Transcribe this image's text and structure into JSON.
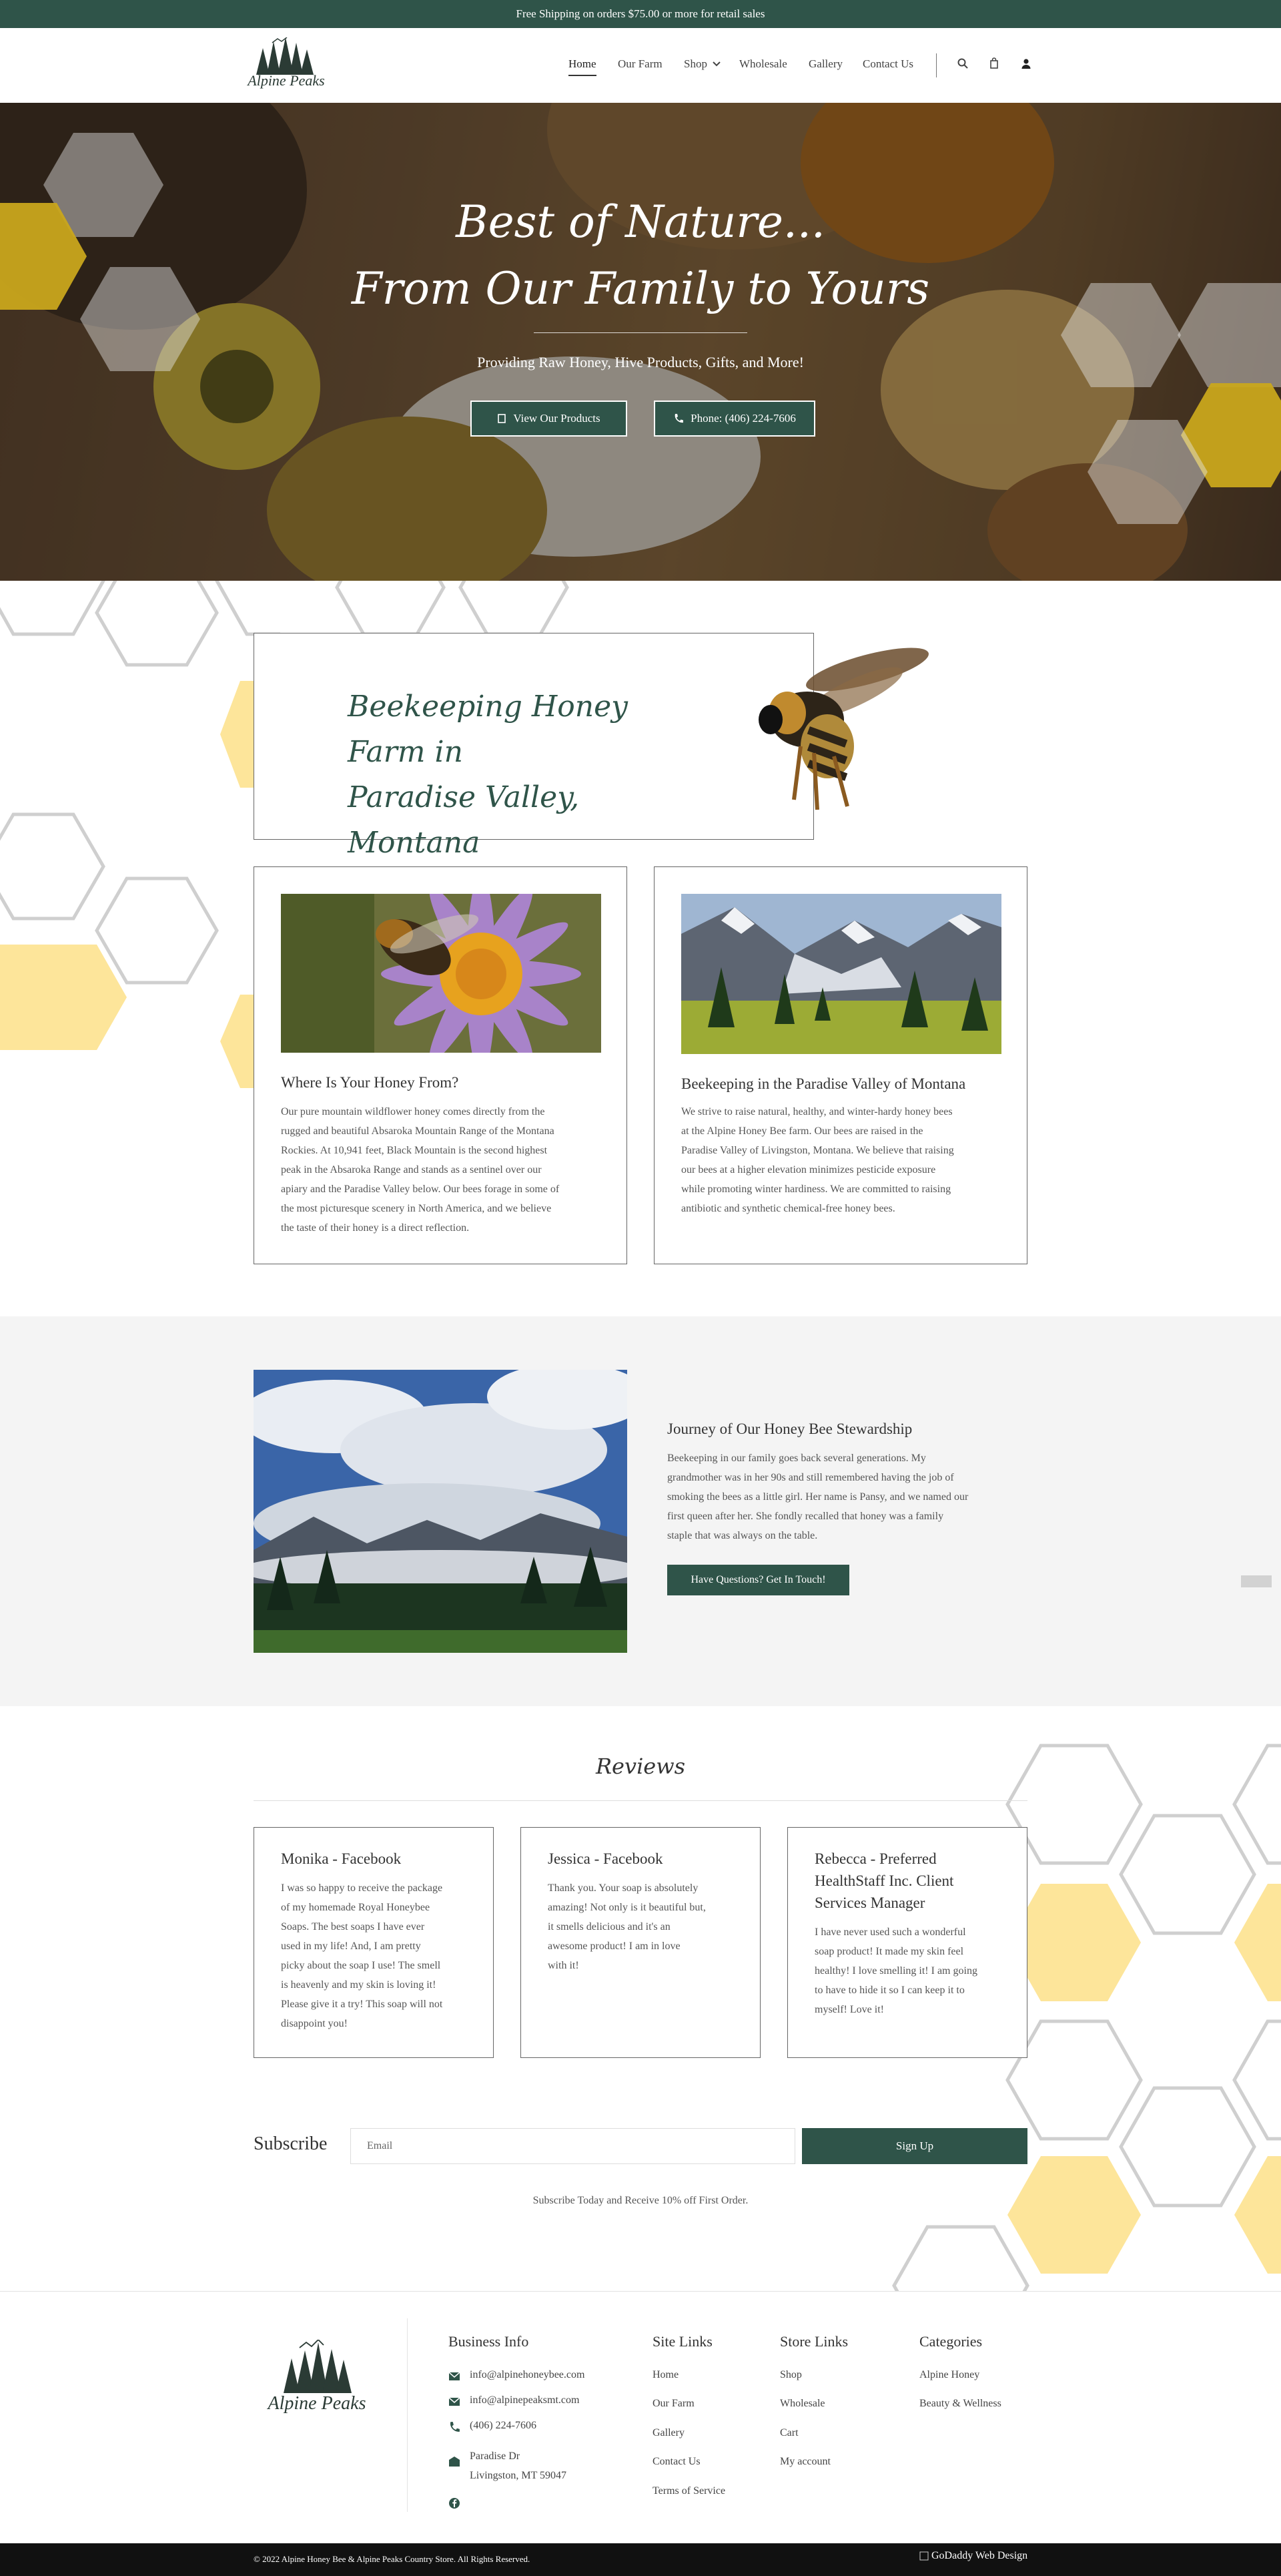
{
  "announcement": "Free Shipping on orders $75.00 or more for retail sales",
  "brand": {
    "name": "Alpine Peaks"
  },
  "nav": {
    "home": "Home",
    "farm": "Our Farm",
    "shop": "Shop",
    "wholesale": "Wholesale",
    "gallery": "Gallery",
    "contact": "Contact Us"
  },
  "hero": {
    "title_line1": "Best of Nature...",
    "title_line2": "From Our Family to Yours",
    "subtitle": "Providing Raw Honey, Hive Products, Gifts, and More!",
    "btn_products": "View Our Products",
    "btn_phone": "Phone: (406) 224-7606"
  },
  "intro": {
    "title_line1": "Beekeeping Honey Farm in",
    "title_line2": "Paradise Valley, Montana"
  },
  "cards": [
    {
      "title": "Where Is Your Honey From?",
      "lines": [
        "Our pure mountain wildflower honey comes directly from the",
        "rugged and beautiful Absaroka Mountain Range of the Montana",
        "Rockies. At 10,941 feet, Black Mountain is the second highest",
        "peak in the Absaroka Range and stands as a sentinel over our",
        "apiary and the Paradise Valley below. Our bees forage in some of",
        "the most picturesque scenery in North America, and we believe",
        "the taste of their honey is a direct reflection."
      ]
    },
    {
      "title": "Beekeeping in the Paradise Valley of Montana",
      "lines": [
        "We strive to raise natural, healthy, and winter-hardy honey bees",
        "at the Alpine Honey Bee farm. Our bees are raised in the",
        "Paradise Valley of Livingston, Montana. We believe that raising",
        "our bees at a higher elevation minimizes pesticide exposure",
        "while promoting winter hardiness. We are committed to raising",
        "antibiotic and synthetic chemical-free honey bees."
      ]
    }
  ],
  "journey": {
    "title": "Journey of Our Honey Bee Stewardship",
    "lines": [
      "Beekeeping in our family goes back several generations. My",
      "grandmother was in her 90s and still remembered having the job of",
      "smoking the bees as a little girl. Her name is Pansy, and we named our",
      "first queen after her. She fondly recalled that honey was a family",
      "staple that was always on the table."
    ],
    "button": "Have Questions? Get In Touch!"
  },
  "reviews": {
    "heading": "Reviews",
    "items": [
      {
        "name_lines": [
          "Monika - Facebook"
        ],
        "lines": [
          "I was so happy to receive the package",
          "of my homemade Royal Honeybee",
          "Soaps. The best soaps I have ever",
          "used in my life! And, I am pretty",
          "picky about the soap I use! The smell",
          "is heavenly and my skin is loving it!",
          "Please give it a try! This soap will not",
          "disappoint you!"
        ]
      },
      {
        "name_lines": [
          "Jessica - Facebook"
        ],
        "lines": [
          "Thank you. Your soap is absolutely",
          "amazing! Not only is it beautiful but,",
          "it smells delicious and it's an",
          "awesome product! I am in love",
          "with it!"
        ]
      },
      {
        "name_lines": [
          "Rebecca - Preferred",
          "HealthStaff Inc. Client",
          "Services Manager"
        ],
        "lines": [
          "I have never used such a wonderful",
          "soap product! It made my skin feel",
          "healthy! I love smelling it! I am going",
          "to have to hide it so I can keep it to",
          "myself! Love it!"
        ]
      }
    ]
  },
  "subscribe": {
    "label": "Subscribe",
    "placeholder": "Email",
    "button": "Sign Up",
    "note": "Subscribe Today and Receive 10% off First Order."
  },
  "footer": {
    "business": {
      "heading": "Business Info",
      "email1": "info@alpinehoneybee.com",
      "email2": "info@alpinepeaksmt.com",
      "phone": "(406) 224-7606",
      "address1": "Paradise Dr",
      "address2": "Livingston, MT 59047"
    },
    "site": {
      "heading": "Site Links",
      "links": [
        "Home",
        "Our Farm",
        "Gallery",
        "Contact Us",
        "Terms of Service"
      ]
    },
    "store": {
      "heading": "Store Links",
      "links": [
        "Shop",
        "Wholesale",
        "Cart",
        "My account"
      ]
    },
    "categories": {
      "heading": "Categories",
      "links": [
        "Alpine Honey",
        "Beauty & Wellness"
      ]
    }
  },
  "copyright": "© 2022 Alpine Honey Bee & Alpine Peaks Country Store. All Rights Reserved.",
  "credit": "GoDaddy Web Design",
  "icons": {
    "search": "search-icon",
    "cart": "cart-icon",
    "account": "user-icon",
    "products": "product-icon",
    "phone": "phone-icon",
    "email": "email-icon",
    "location": "location-icon",
    "facebook": "facebook-icon",
    "chevron": "chevron-down-icon"
  },
  "colors": {
    "brand_green": "#2f5449",
    "honey_yellow": "#fde59a",
    "hex_outline": "#cfcfcf"
  }
}
